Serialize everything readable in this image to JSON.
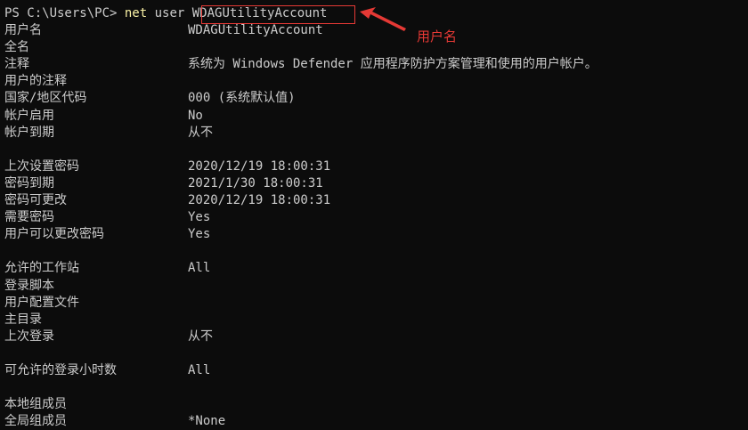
{
  "prompt": {
    "ps": "PS C:\\Users\\PC> ",
    "command": "net",
    "args": " user ",
    "username_arg": "WDAGUtilityAccount"
  },
  "annotation": {
    "label": "用户名",
    "color": "#e53935"
  },
  "rows": [
    {
      "label": "用户名",
      "value": "WDAGUtilityAccount"
    },
    {
      "label": "全名",
      "value": ""
    },
    {
      "label": "注释",
      "value": "系统为 Windows Defender 应用程序防护方案管理和使用的用户帐户。"
    },
    {
      "label": "用户的注释",
      "value": ""
    },
    {
      "label": "国家/地区代码",
      "value": "000 (系统默认值)"
    },
    {
      "label": "帐户启用",
      "value": "No"
    },
    {
      "label": "帐户到期",
      "value": "从不"
    },
    {
      "label": "",
      "value": ""
    },
    {
      "label": "上次设置密码",
      "value": "2020/12/19 18:00:31"
    },
    {
      "label": "密码到期",
      "value": "2021/1/30 18:00:31"
    },
    {
      "label": "密码可更改",
      "value": "2020/12/19 18:00:31"
    },
    {
      "label": "需要密码",
      "value": "Yes"
    },
    {
      "label": "用户可以更改密码",
      "value": "Yes"
    },
    {
      "label": "",
      "value": ""
    },
    {
      "label": "允许的工作站",
      "value": "All"
    },
    {
      "label": "登录脚本",
      "value": ""
    },
    {
      "label": "用户配置文件",
      "value": ""
    },
    {
      "label": "主目录",
      "value": ""
    },
    {
      "label": "上次登录",
      "value": "从不"
    },
    {
      "label": "",
      "value": ""
    },
    {
      "label": "可允许的登录小时数",
      "value": "All"
    },
    {
      "label": "",
      "value": ""
    },
    {
      "label": "本地组成员",
      "value": ""
    },
    {
      "label": "全局组成员",
      "value": "*None"
    }
  ]
}
